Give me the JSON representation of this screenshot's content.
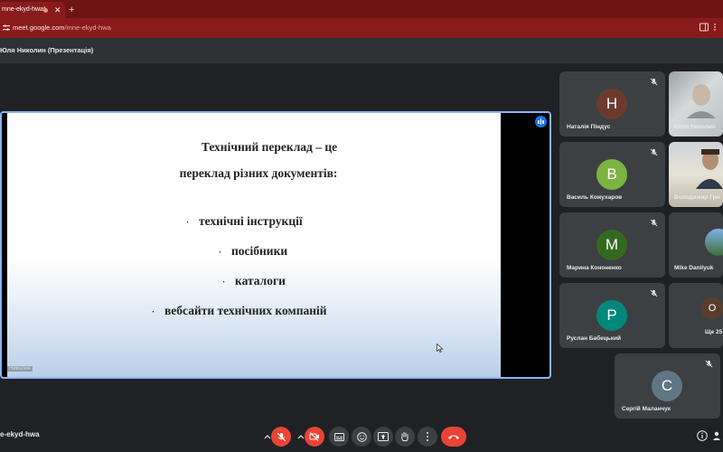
{
  "browser": {
    "tab_title": "mne-ekyd-hwa*",
    "new_tab_label": "+",
    "close_label": "✕",
    "url_host": "meet.google.com",
    "url_path": "/mne-ekyd-hwa"
  },
  "header": {
    "presenter_title": "Юля Николин (Презентація)"
  },
  "slide": {
    "title_line1": "Технічний переклад – це",
    "title_line2": "переклад різних документів:",
    "bullets": [
      "технічні інструкції",
      "посібники",
      "каталоги",
      "вебсайти технічних компаній"
    ],
    "bullet_symbol": "·",
    "presenter_label": "Николин"
  },
  "participants": [
    {
      "name": "Наталія Піндус",
      "initial": "Н",
      "color": "#6d3a2e",
      "muted": true
    },
    {
      "name": "Юлія Николин",
      "video": true,
      "muted": false
    },
    {
      "name": "Василь Кожухаров",
      "initial": "В",
      "color": "#7cb342",
      "muted": true
    },
    {
      "name": "Володимир Гри",
      "video": true,
      "muted": false
    },
    {
      "name": "Марина Кононенко",
      "initial": "М",
      "color": "#33691e",
      "muted": true
    },
    {
      "name": "Mike Danilyuk",
      "video": true,
      "muted": true
    },
    {
      "name": "Руслан Бабецький",
      "initial": "Р",
      "color": "#00897b",
      "muted": true
    },
    {
      "name": "Ще 25",
      "initial": "О",
      "color": "#5b3d2e",
      "muted": false
    },
    {
      "name": "Сергій Маланчук",
      "initial": "С",
      "color": "#5f7785",
      "muted": true
    }
  ],
  "bottombar": {
    "meeting_code": "e-ekyd-hwa"
  },
  "colors": {
    "accent": "#8ab4f8",
    "danger": "#ea4335"
  }
}
